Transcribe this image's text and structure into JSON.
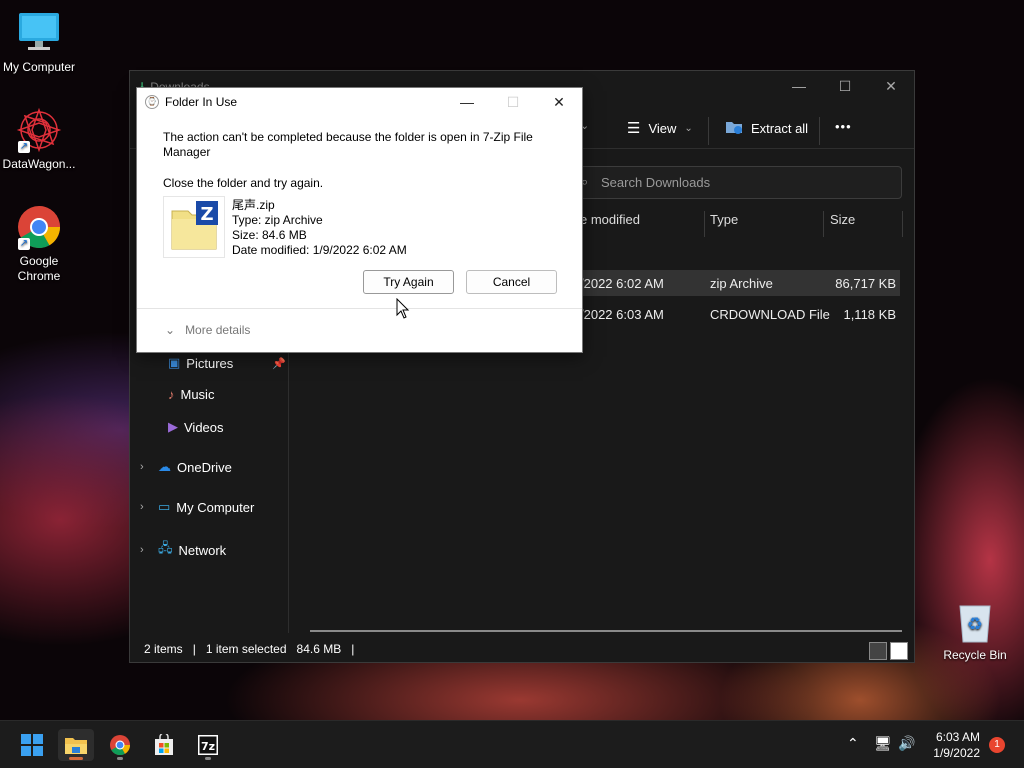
{
  "desktop": {
    "icons": [
      {
        "label": "My Computer",
        "icon": "monitor-icon"
      },
      {
        "label": "DataWagon...",
        "icon": "mandala-icon"
      },
      {
        "label": "Google Chrome",
        "icon": "chrome-icon"
      },
      {
        "label": "Recycle Bin",
        "icon": "recycle-bin-icon"
      }
    ]
  },
  "explorer": {
    "title": "Downloads",
    "toolbar": {
      "sort_chevron": "⌄",
      "view_label": "View",
      "extract_label": "Extract all",
      "more_label": "•••"
    },
    "search_placeholder": "Search Downloads",
    "columns": {
      "date": "e modified",
      "type": "Type",
      "size": "Size"
    },
    "rows": [
      {
        "date": "/2022 6:02 AM",
        "type": "zip Archive",
        "size": "86,717 KB",
        "selected": true
      },
      {
        "date": "/2022 6:03 AM",
        "type": "CRDOWNLOAD File",
        "size": "1,118 KB",
        "selected": false
      }
    ],
    "nav": {
      "pictures": "Pictures",
      "music": "Music",
      "videos": "Videos",
      "onedrive": "OneDrive",
      "mycomputer": "My Computer",
      "network": "Network"
    },
    "status": {
      "items": "2 items",
      "selected": "1 item selected",
      "size": "84.6 MB"
    }
  },
  "dialog": {
    "title": "Folder In Use",
    "message": "The action can't be completed because the folder is open in 7-Zip File Manager",
    "instruction": "Close the folder and try again.",
    "file": {
      "name": "尾声.zip",
      "type": "Type: zip Archive",
      "size": "Size: 84.6 MB",
      "date": "Date modified: 1/9/2022 6:02 AM"
    },
    "try_again": "Try Again",
    "cancel": "Cancel",
    "more_details": "More details"
  },
  "taskbar": {
    "apps": [
      "start-icon",
      "file-explorer-icon",
      "chrome-icon",
      "store-icon",
      "7zip-icon"
    ],
    "time": "6:03 AM",
    "date": "1/9/2022",
    "notifications": "1"
  },
  "colors": {
    "accent": "#d36a3a",
    "selection": "#333333",
    "dialog_bg": "#ffffff"
  }
}
